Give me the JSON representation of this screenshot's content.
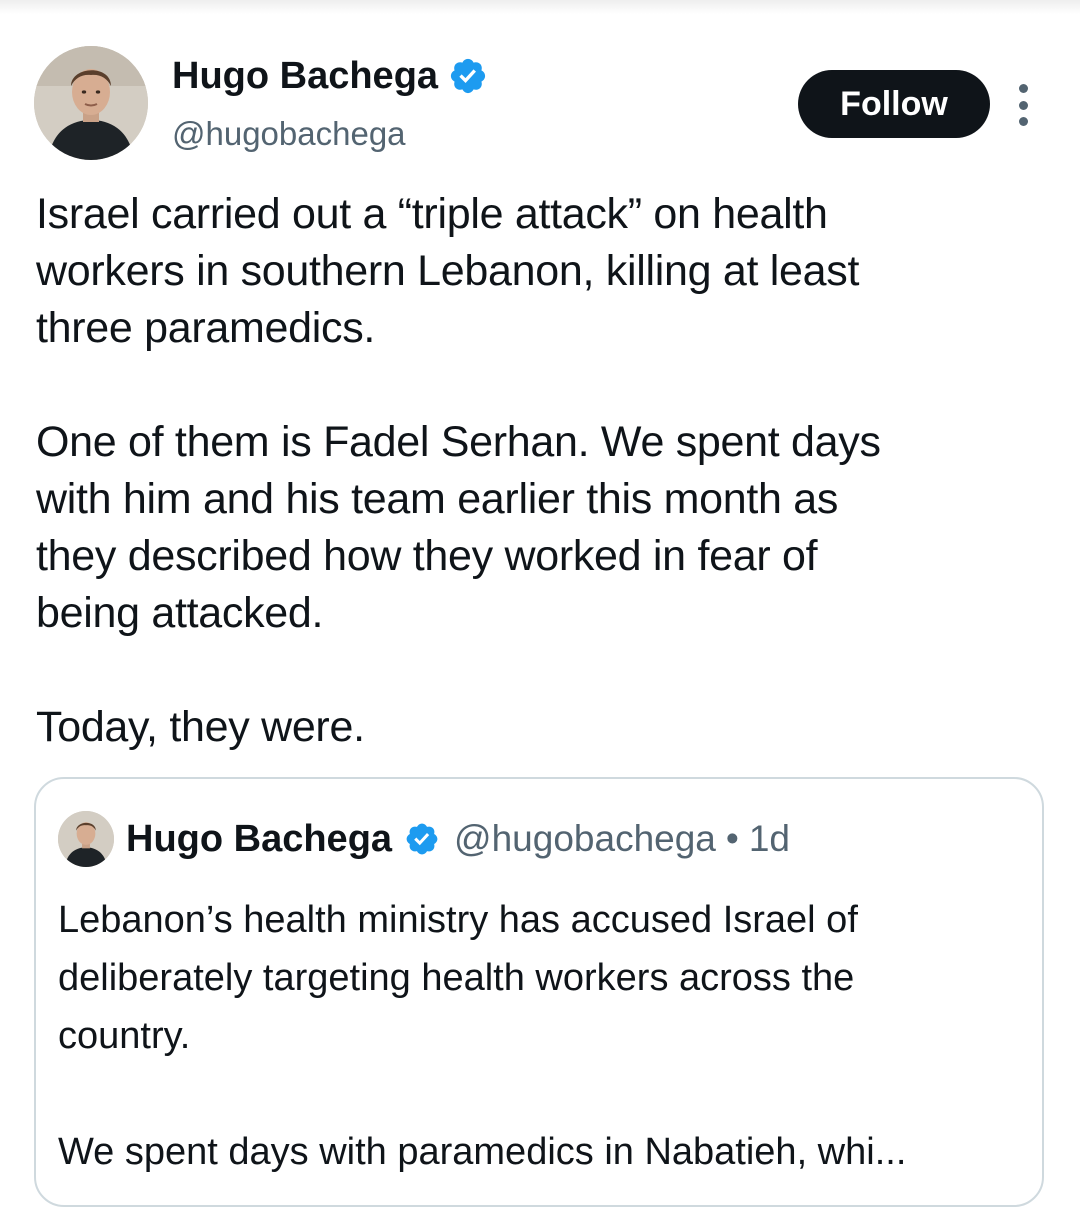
{
  "tweet": {
    "author": {
      "name": "Hugo Bachega",
      "handle": "@hugobachega",
      "verified": true
    },
    "follow_label": "Follow",
    "more_icon": "more-vertical-icon",
    "lines_p1": [
      "Israel carried out a “triple attack” on health",
      "workers in southern Lebanon, killing at least",
      "three paramedics."
    ],
    "lines_p2": [
      "One of them is Fadel Serhan. We spent days",
      "with him and his team earlier this month as",
      "they described how they worked in fear of",
      "being attacked."
    ],
    "lines_p3": [
      "Today, they were."
    ]
  },
  "quote": {
    "author": {
      "name": "Hugo Bachega",
      "handle": "@hugobachega",
      "verified": true
    },
    "dot": "•",
    "time": "1d",
    "lines_p1": [
      "Lebanon’s health ministry has accused Israel of",
      "deliberately targeting health workers across the",
      "country."
    ],
    "lines_p2": [
      "We spent days with paramedics in Nabatieh, whi..."
    ]
  },
  "colors": {
    "verified_blue": "#1d9bf0",
    "follow_bg": "#0f1419",
    "secondary_text": "#536471",
    "border": "#cfd9de"
  }
}
